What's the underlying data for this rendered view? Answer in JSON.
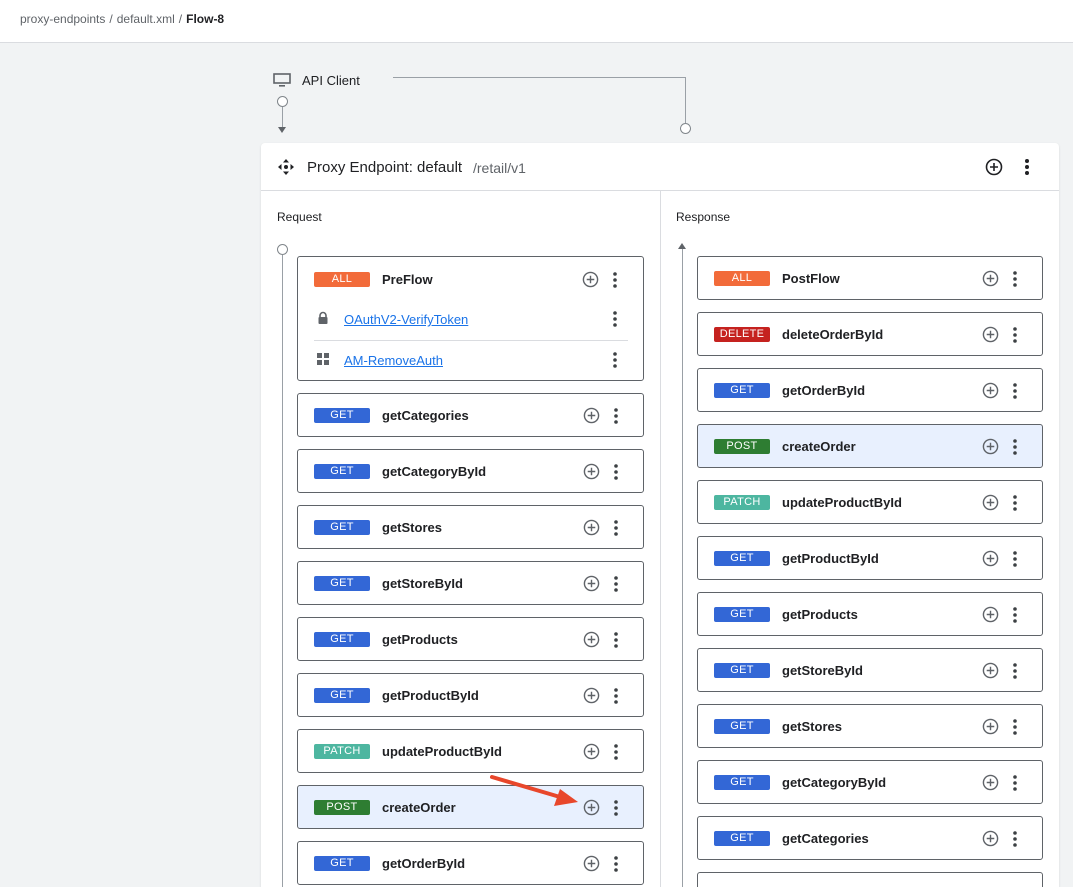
{
  "breadcrumb": {
    "items": [
      "proxy-endpoints",
      "default.xml"
    ],
    "separator": "/",
    "current": "Flow-8"
  },
  "client": {
    "label": "API Client",
    "icon": "monitor-icon"
  },
  "proxy": {
    "title": "Proxy Endpoint: default",
    "path": "/retail/v1",
    "icon": "move-icon"
  },
  "request": {
    "title": "Request",
    "preflow": {
      "method": "ALL",
      "name": "PreFlow",
      "policies": [
        {
          "name": "OAuthV2-VerifyToken",
          "icon": "lock-icon"
        },
        {
          "name": "AM-RemoveAuth",
          "icon": "grid-icon"
        }
      ]
    },
    "flows": [
      {
        "method": "GET",
        "name": "getCategories"
      },
      {
        "method": "GET",
        "name": "getCategoryById"
      },
      {
        "method": "GET",
        "name": "getStores"
      },
      {
        "method": "GET",
        "name": "getStoreById"
      },
      {
        "method": "GET",
        "name": "getProducts"
      },
      {
        "method": "GET",
        "name": "getProductById"
      },
      {
        "method": "PATCH",
        "name": "updateProductById"
      },
      {
        "method": "POST",
        "name": "createOrder",
        "selected": true
      },
      {
        "method": "GET",
        "name": "getOrderById"
      }
    ]
  },
  "response": {
    "title": "Response",
    "flows": [
      {
        "method": "ALL",
        "name": "PostFlow"
      },
      {
        "method": "DELETE",
        "name": "deleteOrderById"
      },
      {
        "method": "GET",
        "name": "getOrderById"
      },
      {
        "method": "POST",
        "name": "createOrder",
        "selected": true
      },
      {
        "method": "PATCH",
        "name": "updateProductById"
      },
      {
        "method": "GET",
        "name": "getProductById"
      },
      {
        "method": "GET",
        "name": "getProducts"
      },
      {
        "method": "GET",
        "name": "getStoreById"
      },
      {
        "method": "GET",
        "name": "getStores"
      },
      {
        "method": "GET",
        "name": "getCategoryById"
      },
      {
        "method": "GET",
        "name": "getCategories"
      }
    ]
  },
  "colors": {
    "ALL": "#f26b3a",
    "GET": "#3367d6",
    "POST": "#2e7d32",
    "PATCH": "#4db6a0",
    "DELETE": "#c5221f",
    "selected_bg": "#e8f0fe",
    "annotation_arrow": "#e8472b"
  }
}
